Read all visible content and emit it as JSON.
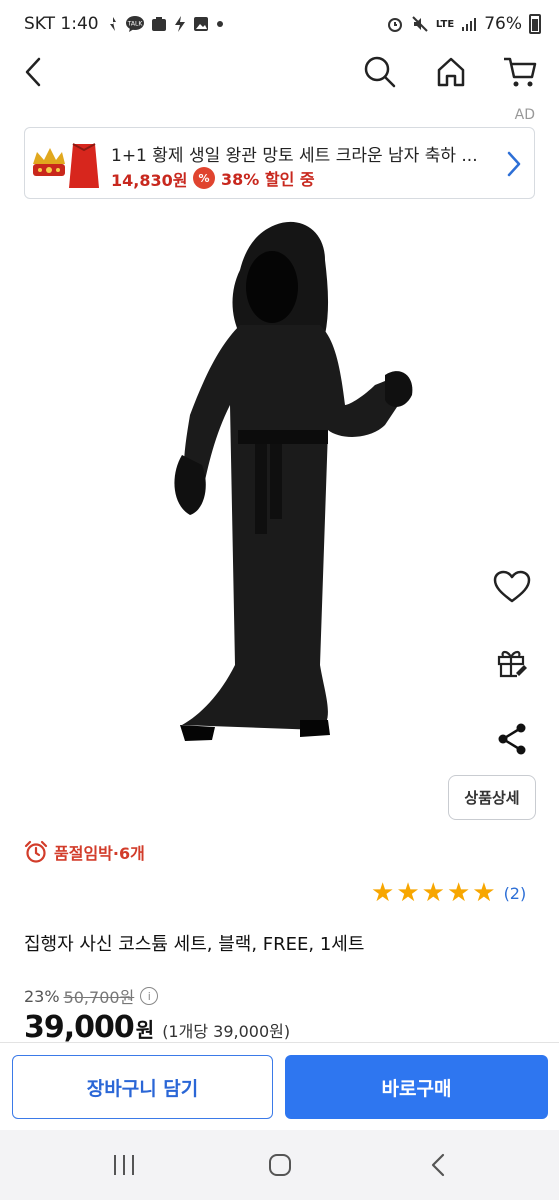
{
  "status_bar": {
    "carrier_time": "SKT 1:40",
    "notification_icons": [
      "notification-icon",
      "talk-icon",
      "app-icon",
      "bolt-icon",
      "image-icon",
      "dot-icon"
    ],
    "network": "LTE",
    "battery": "76%"
  },
  "ad_label": "AD",
  "banner": {
    "title": "1+1 황제 생일 왕관 망토 세트 크라운 남자 축하 ...",
    "price": "14,830원",
    "discount": "38% 할인 중",
    "badge": "%"
  },
  "detail_button": "상품상세",
  "stock": {
    "text": "품절임박·6개"
  },
  "rating": {
    "stars": 5,
    "count": "(2)",
    "star_color": "#f7a600"
  },
  "product": {
    "title": "집행자 사신 코스튬 세트, 블랙, FREE, 1세트",
    "discount_rate": "23%",
    "original_price": "50,700원",
    "info": "i",
    "sale_price": "39,000",
    "won": "원",
    "unit_price": "(1개당 39,000원)"
  },
  "actions": {
    "cart": "장바구니 담기",
    "buy": "바로구매"
  },
  "colors": {
    "accent": "#2e76f0",
    "sale_red": "#c8281e"
  }
}
